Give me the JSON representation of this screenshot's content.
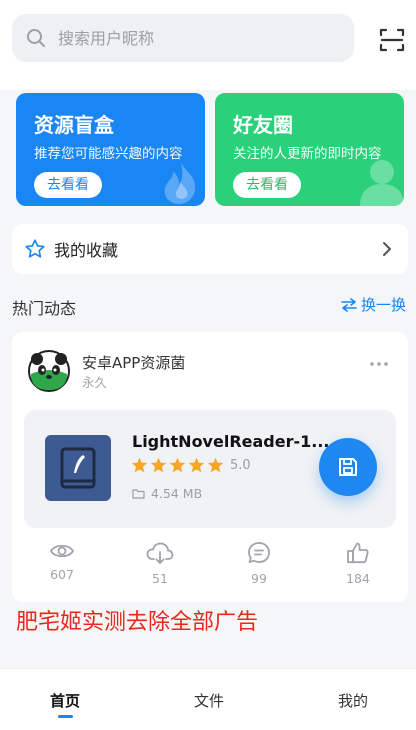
{
  "search": {
    "placeholder": "搜索用户昵称"
  },
  "cards": [
    {
      "title": "资源盲盒",
      "desc": "推荐您可能感兴趣的内容",
      "button": "去看看"
    },
    {
      "title": "好友圈",
      "desc": "关注的人更新的即时内容",
      "button": "去看看"
    }
  ],
  "favorites": {
    "label": "我的收藏"
  },
  "hot": {
    "title": "热门动态",
    "refresh": "换一换"
  },
  "post": {
    "author": "安卓APP资源菌",
    "subtitle": "永久",
    "app": {
      "name": "LightNovelReader-1...",
      "rating": "5.0",
      "stars": 5,
      "size": "4.54 MB"
    },
    "stats": {
      "views": "607",
      "downloads": "51",
      "comments": "99",
      "likes": "184"
    }
  },
  "promo_text": "肥宅姬实测去除全部广告",
  "nav": {
    "home": "首页",
    "files": "文件",
    "mine": "我的"
  },
  "colors": {
    "accent": "#1a86f3",
    "green": "#2bd07a",
    "star": "#f5a623",
    "promo": "#e8281d"
  },
  "icons": [
    "search-icon",
    "scan-icon",
    "fire-icon",
    "person-icon",
    "star-outline-icon",
    "chevron-right-icon",
    "swap-icon",
    "more-icon",
    "book-icon",
    "download-icon",
    "folder-icon",
    "eye-icon",
    "cloud-download-icon",
    "comment-icon",
    "thumbs-up-icon"
  ]
}
